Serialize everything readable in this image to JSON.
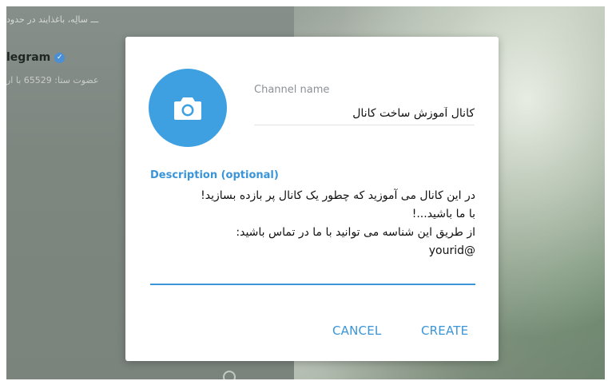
{
  "background": {
    "chat_preview_line": "ـــ سالِه، باغذایند در حدود",
    "chat_name": "legram",
    "chat_subtitle": "عضوت ستا: 65529 با ار"
  },
  "dialog": {
    "channel_name_label": "Channel name",
    "channel_name_value": "کانال آموزش ساخت کانال",
    "description_label": "Description (optional)",
    "description_value": "در این کانال می آموزید که چطور یک کانال پر بازده بسازید!\nبا ما باشید...!\nاز طریق این شناسه می توانید با ما در تماس باشید:\n@yourid",
    "cancel_label": "CANCEL",
    "create_label": "CREATE"
  },
  "colors": {
    "accent": "#3a95d8",
    "avatar": "#3ea0e0"
  },
  "icons": {
    "avatar_icon": "camera-icon",
    "verified_icon": "verified-badge-icon"
  }
}
